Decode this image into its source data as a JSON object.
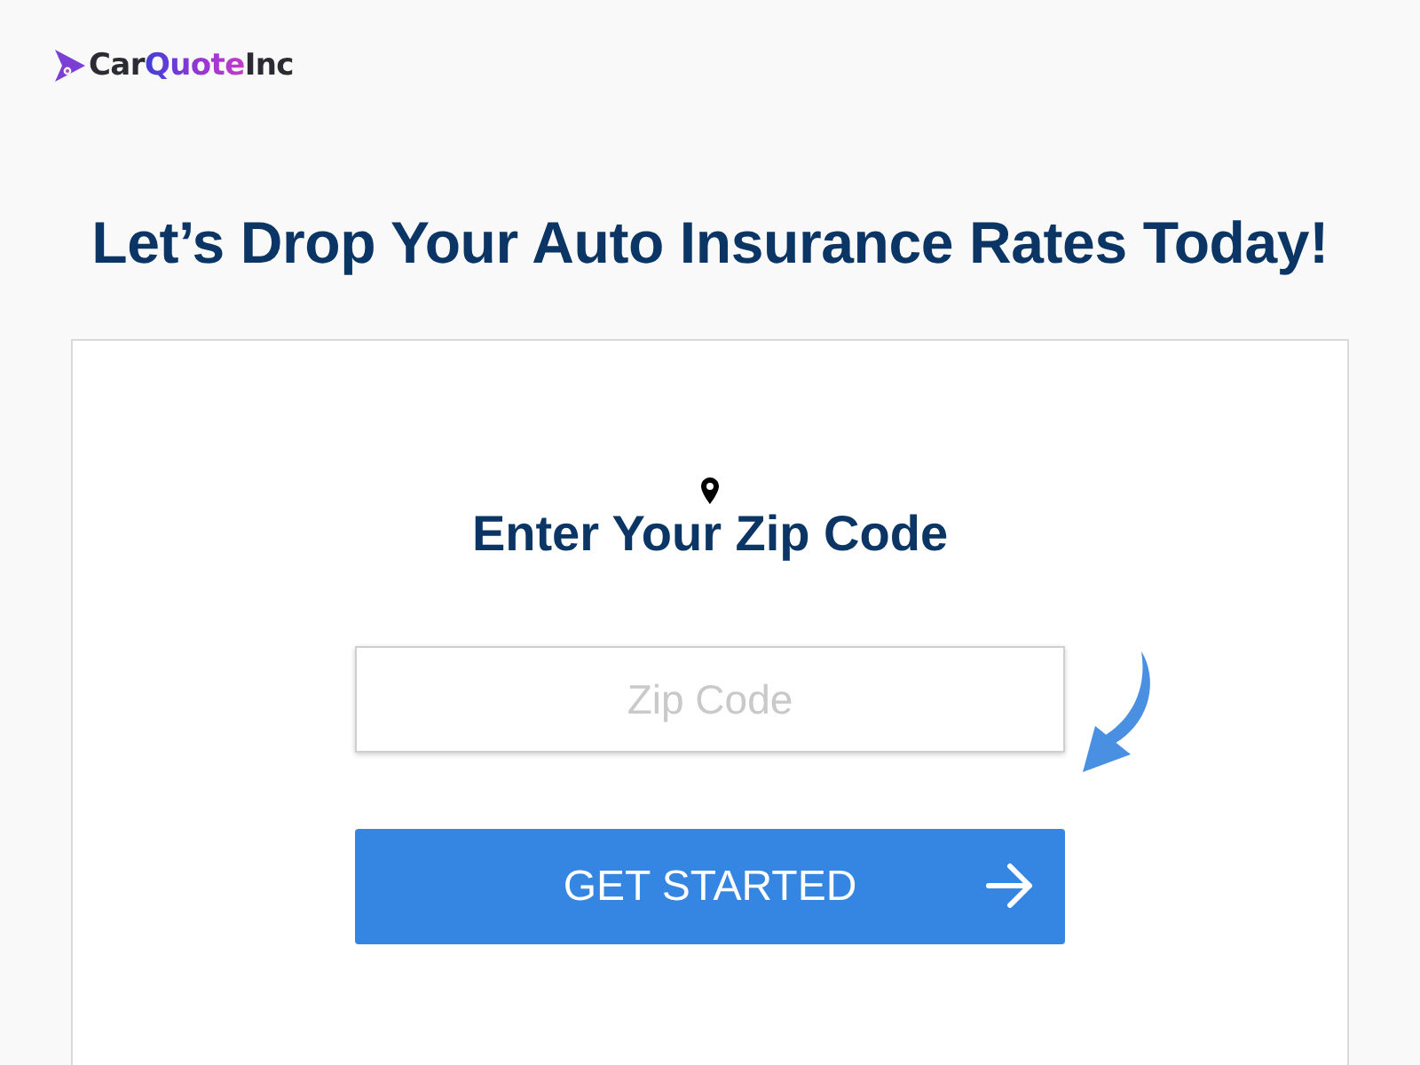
{
  "logo": {
    "parts": [
      {
        "text": "Car",
        "accent": false
      },
      {
        "text": "Quote",
        "accent": true
      },
      {
        "text": "Inc",
        "accent": false
      }
    ]
  },
  "headline": "Let’s Drop Your Auto Insurance Rates Today!",
  "zip_form": {
    "title": "Enter Your Zip Code",
    "zip_field": {
      "placeholder": "Zip Code"
    },
    "submit_button": {
      "label": "GET STARTED"
    }
  }
}
